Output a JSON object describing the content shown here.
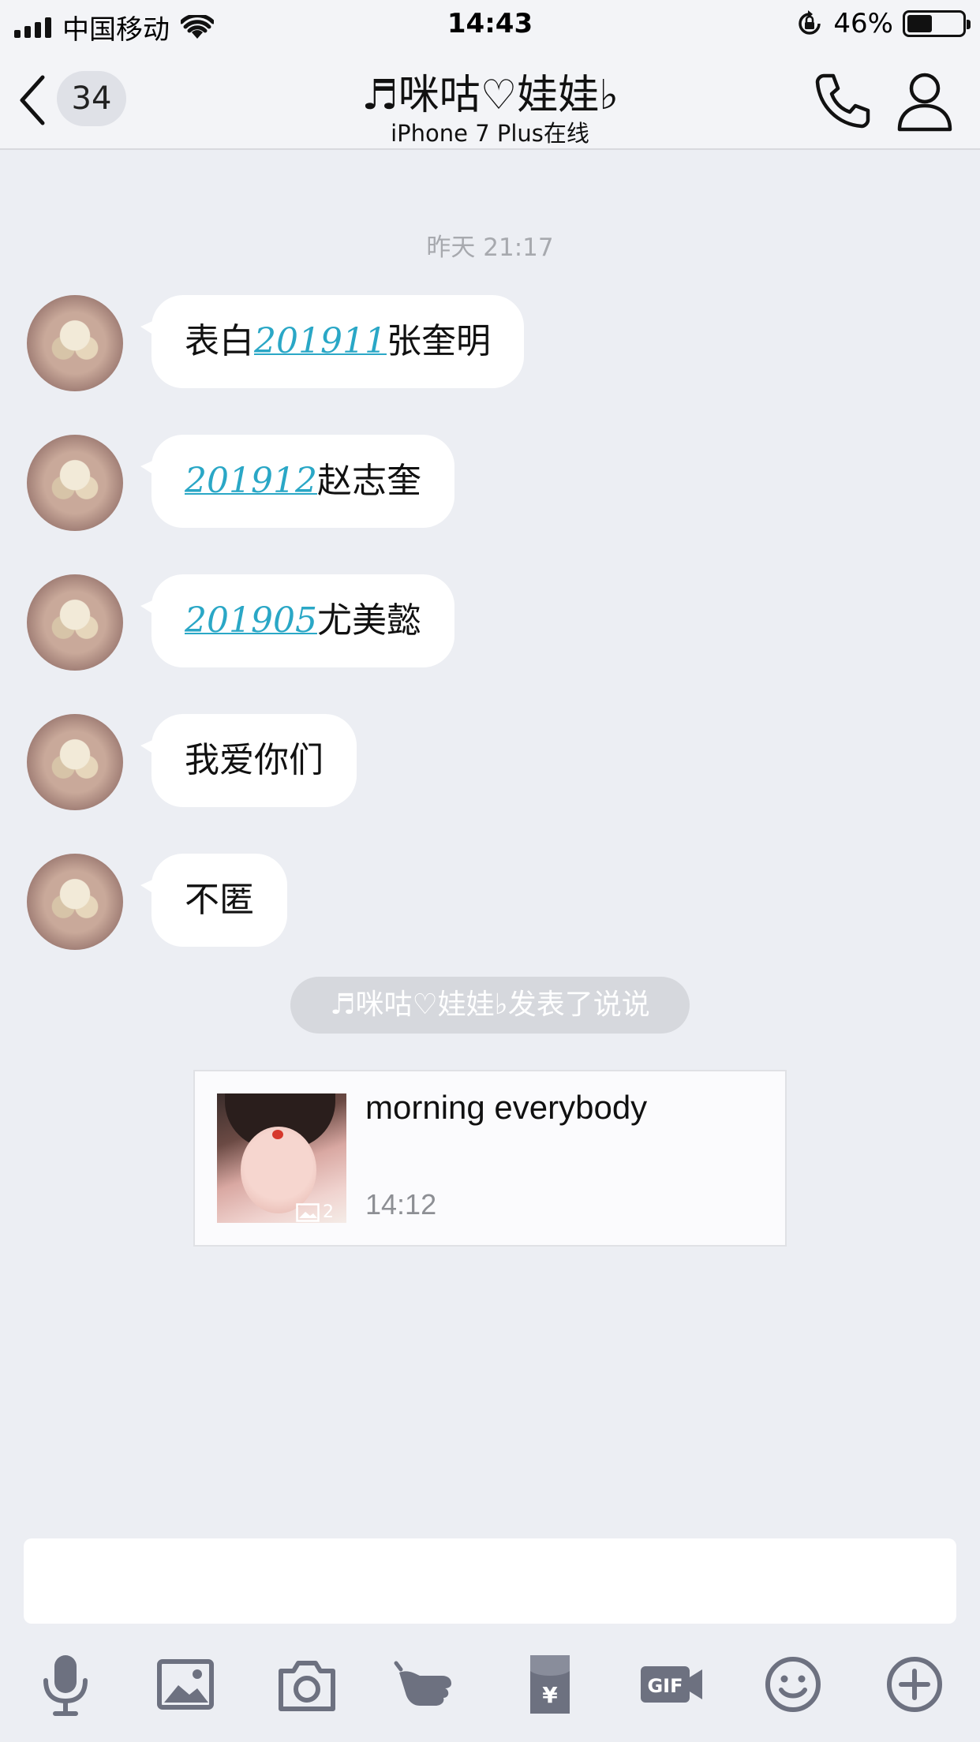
{
  "status_bar": {
    "carrier": "中国移动",
    "time": "14:43",
    "battery_percent": "46%",
    "battery_level": 0.46
  },
  "nav": {
    "unread_count": "34",
    "title": "♬咪咕♡娃娃♭",
    "subtitle": "iPhone 7 Plus在线"
  },
  "chat": {
    "timestamp": "昨天 21:17",
    "messages": [
      {
        "pre": "表白",
        "link": "201911",
        "post": "张奎明"
      },
      {
        "pre": "",
        "link": "201912",
        "post": "赵志奎"
      },
      {
        "pre": "",
        "link": "201905",
        "post": "尤美懿"
      },
      {
        "pre": "我爱你们",
        "link": "",
        "post": ""
      },
      {
        "pre": "不匿",
        "link": "",
        "post": ""
      }
    ],
    "system_notice": "♬咪咕♡娃娃♭发表了说说",
    "post_card": {
      "title": "morning everybody",
      "time": "14:12",
      "image_count": "2"
    }
  },
  "toolbar": {
    "items": [
      "microphone-icon",
      "image-icon",
      "camera-icon",
      "poke-icon",
      "red-packet-icon",
      "gif-icon",
      "emoji-icon",
      "plus-icon"
    ]
  },
  "colors": {
    "background": "#eceef3",
    "link": "#2aa7c6",
    "bubble": "#ffffff",
    "icon": "#6d7180"
  }
}
